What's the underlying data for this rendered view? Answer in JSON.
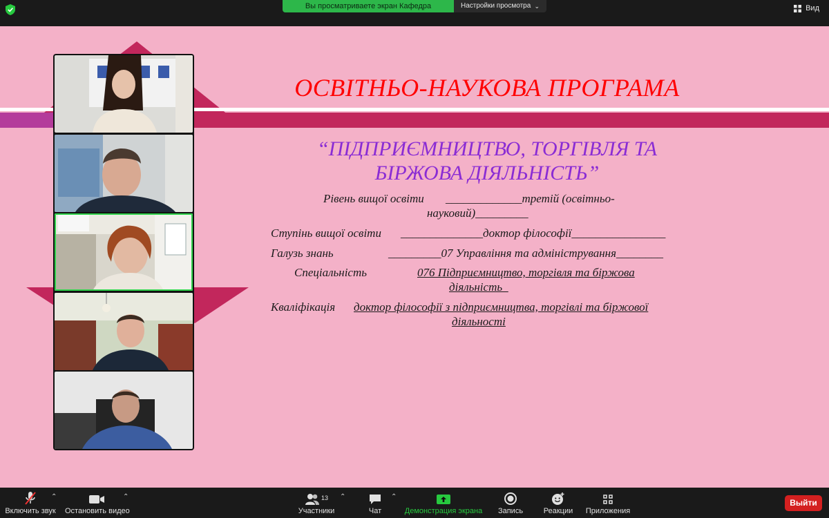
{
  "topbar": {
    "share_banner": "Вы просматриваете экран Кафедра",
    "view_options": "Настройки просмотра",
    "view_button": "Вид"
  },
  "slide": {
    "title": "ОСВІТНЬО-НАУКОВА ПРОГРАМА",
    "subtitle_line1": "“ПІДПРИЄМНИЦТВО,  ТОРГІВЛЯ ТА",
    "subtitle_line2": "БІРЖОВА ДІЯЛЬНІСТЬ”",
    "rows": {
      "level_label": "Рівень вищої освіти",
      "level_value_1": "_____________третій (освітньо-",
      "level_value_2": "науковий)_________",
      "degree_label": "Ступінь вищої освіти",
      "degree_value": "______________доктор філософії________________",
      "field_label": "Галузь знань",
      "field_value": "_________07 Управління та адміністрування________",
      "specialty_label": "Спеціальність",
      "specialty_value_1": "076 Підприємництво, торгівля та біржова",
      "specialty_value_2": "діяльність_",
      "qual_label": "Кваліфікація",
      "qual_value_1": "доктор філософії з підприємництва, торгівлі та біржової",
      "qual_value_2": "діяльності"
    }
  },
  "toolbar": {
    "mute": "Включить звук",
    "video": "Остановить видео",
    "participants": "Участники",
    "participants_count": "13",
    "chat": "Чат",
    "share": "Демонстрация экрана",
    "record": "Запись",
    "reactions": "Реакции",
    "apps": "Приложения",
    "leave": "Выйти"
  },
  "colors": {
    "slide_bg": "#f4b1c8",
    "title": "#ff0000",
    "subtitle": "#8a2cd4",
    "band": "#c2275c",
    "share_green": "#2db74a",
    "leave_red": "#d42020"
  },
  "icons": [
    "shield-icon",
    "grid-icon",
    "mic-muted-icon",
    "camera-icon",
    "participants-icon",
    "chat-icon",
    "share-screen-icon",
    "record-icon",
    "reactions-icon",
    "apps-icon"
  ]
}
